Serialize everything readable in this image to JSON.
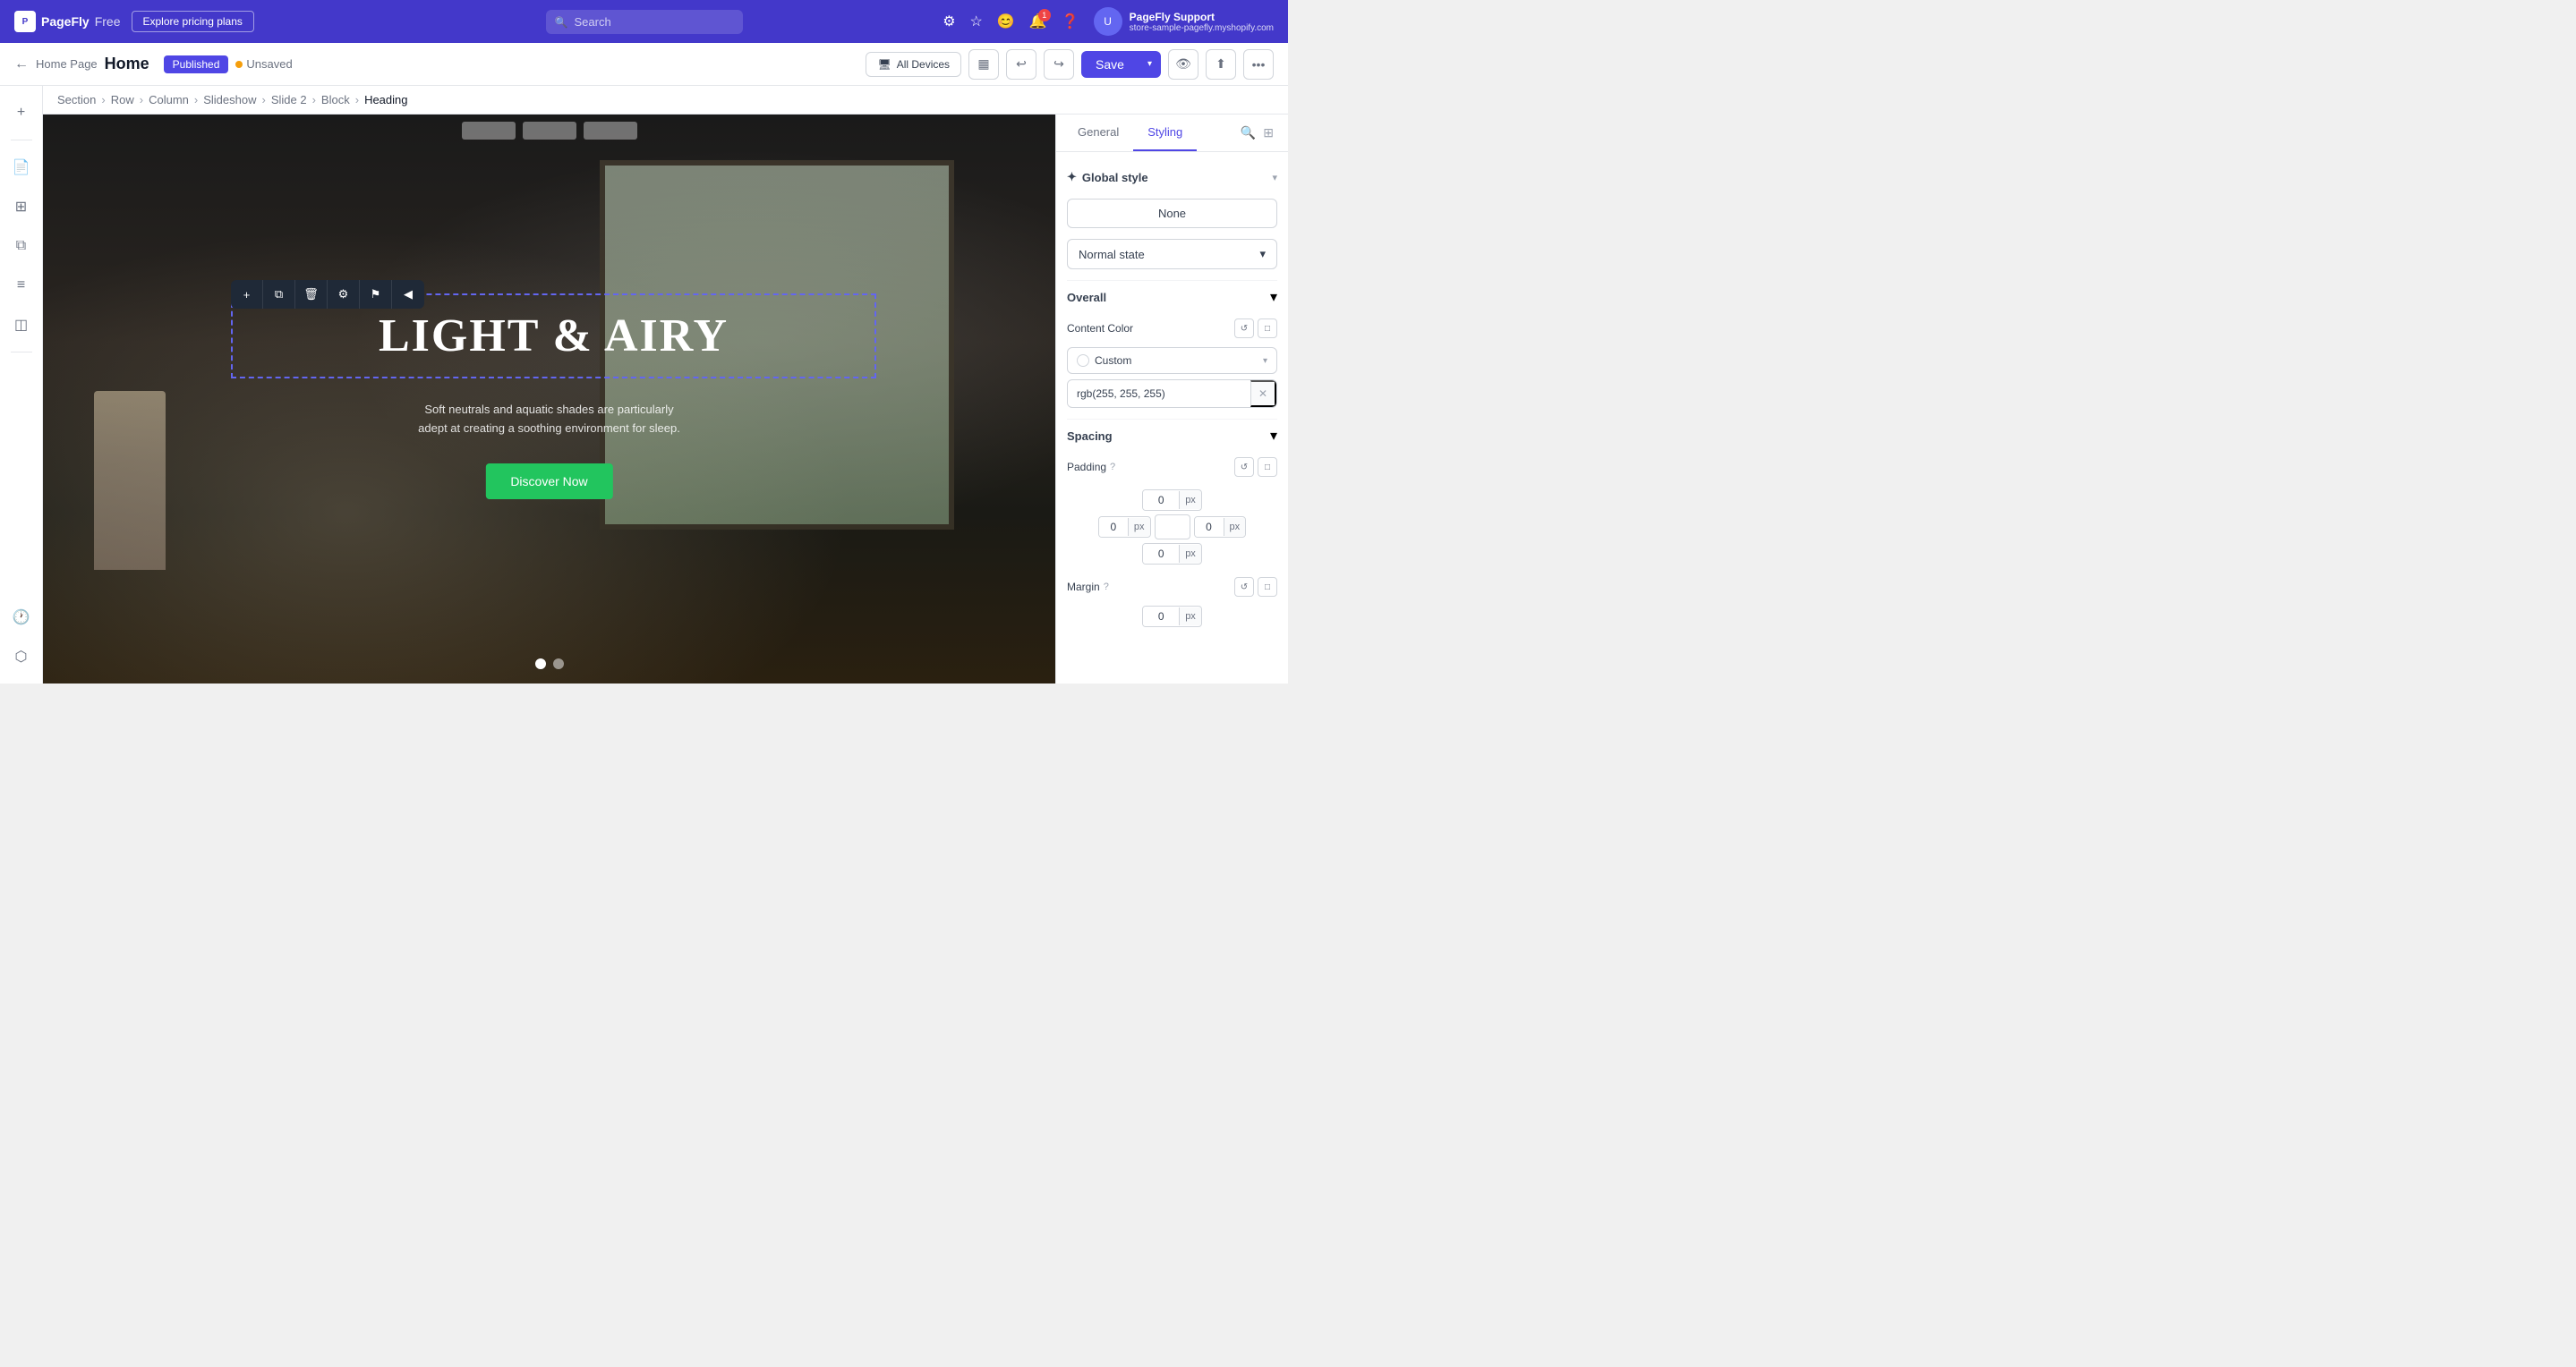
{
  "topbar": {
    "brand": "PageFly",
    "plan": "Free",
    "explore_btn": "Explore pricing plans",
    "search_placeholder": "Search",
    "user_name": "PageFly Support",
    "user_store": "store-sample-pagefly.myshopify.com",
    "notif_count": "1"
  },
  "header": {
    "back_label": "Home Page",
    "page_title": "Home",
    "published_label": "Published",
    "unsaved_label": "Unsaved",
    "all_devices_label": "All Devices",
    "save_label": "Save"
  },
  "breadcrumb": {
    "items": [
      "Section",
      "Row",
      "Column",
      "Slideshow",
      "Slide 2",
      "Block",
      "Heading"
    ]
  },
  "canvas": {
    "heading_text": "LIGHT & AIRY",
    "subtitle": "Soft neutrals and aquatic shades are particularly adept at creating a soothing environment for sleep.",
    "discover_btn": "Discover Now"
  },
  "right_panel": {
    "tabs": [
      "General",
      "Styling"
    ],
    "active_tab": "Styling",
    "global_style_title": "Global style",
    "global_style_value": "None",
    "state_label": "Normal state",
    "overall_title": "Overall",
    "content_color_label": "Content Color",
    "color_value_name": "Custom",
    "color_rgb": "rgb(255, 255, 255)",
    "spacing_title": "Spacing",
    "padding_label": "Padding",
    "margin_label": "Margin",
    "padding_top": "0",
    "padding_left": "0",
    "padding_right": "0",
    "padding_bottom": "0",
    "px_label": "px"
  },
  "element_toolbar": {
    "add_icon": "+",
    "copy_icon": "⧉",
    "delete_icon": "🗑",
    "settings_icon": "⚙",
    "link_icon": "🔗",
    "arrow_icon": "◀"
  }
}
